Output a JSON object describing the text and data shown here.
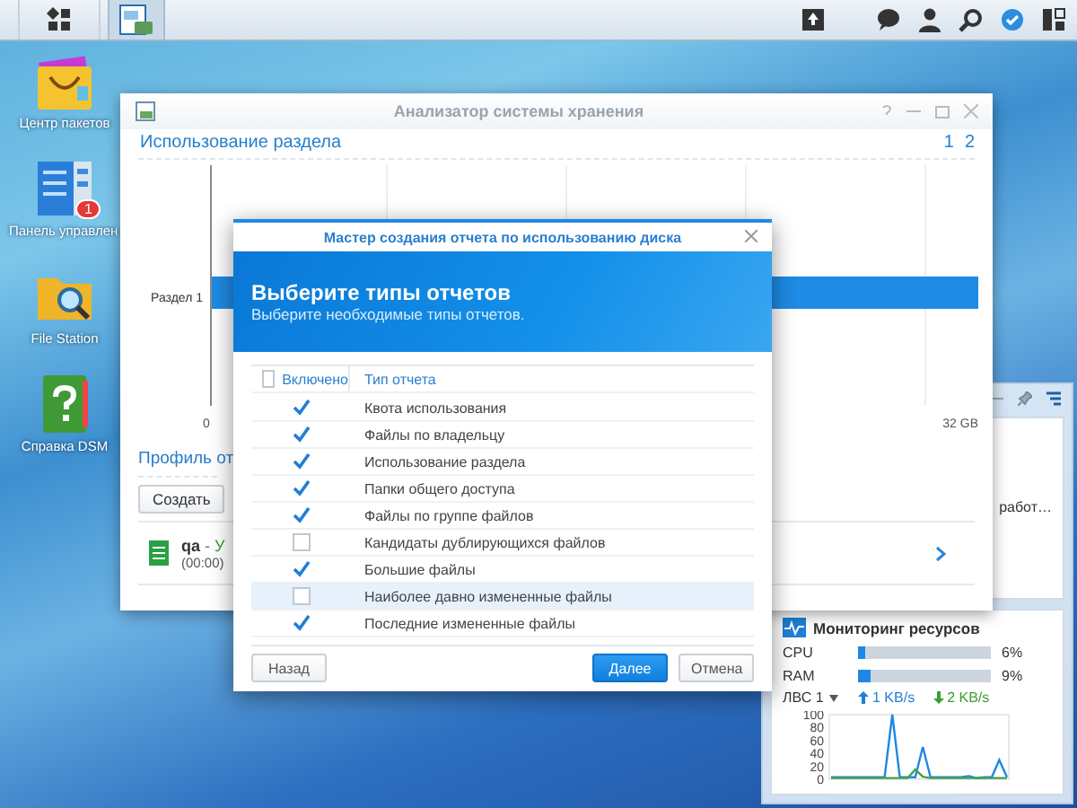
{
  "desktop_icons": [
    {
      "kind": "package",
      "label": "Центр пакетов"
    },
    {
      "kind": "control",
      "label": "Панель управлен",
      "badge": "1"
    },
    {
      "kind": "folder",
      "label": "File Station"
    },
    {
      "kind": "help",
      "label": "Справка DSM"
    }
  ],
  "analyzer_window": {
    "title": "Анализатор системы хранения",
    "section_title": "Использование раздела",
    "pages": [
      "1",
      "2"
    ],
    "chart": {
      "category": "Раздел 1",
      "axis_labels": [
        "0",
        "32 GB"
      ]
    },
    "profile_title": "Профиль от",
    "buttons": [
      "Создать"
    ],
    "report": {
      "name": "qa",
      "status": "- У",
      "time": "(00:00)"
    }
  },
  "wizard": {
    "title": "Мастер создания отчета по использованию диска",
    "heading": "Выберите типы отчетов",
    "subheading": "Выберите необходимые типы отчетов.",
    "columns": [
      "Включено",
      "Тип отчета"
    ],
    "header_checked": false,
    "rows": [
      {
        "label": "Квота использования",
        "checked": true,
        "selected": false
      },
      {
        "label": "Файлы по владельцу",
        "checked": true,
        "selected": false
      },
      {
        "label": "Использование раздела",
        "checked": true,
        "selected": false
      },
      {
        "label": "Папки общего доступа",
        "checked": true,
        "selected": false
      },
      {
        "label": "Файлы по группе файлов",
        "checked": true,
        "selected": false
      },
      {
        "label": "Кандидаты дублирующихся файлов",
        "checked": false,
        "selected": false
      },
      {
        "label": "Большие файлы",
        "checked": true,
        "selected": false
      },
      {
        "label": "Наиболее давно измененные файлы",
        "checked": false,
        "selected": true
      },
      {
        "label": "Последние измененные файлы",
        "checked": true,
        "selected": false
      }
    ],
    "buttons": [
      {
        "label": "Назад",
        "kind": "secondary"
      },
      {
        "label": "Далее",
        "kind": "primary"
      },
      {
        "label": "Отмена",
        "kind": "secondary"
      }
    ]
  },
  "widgets": {
    "status_text": "работ…",
    "monitor": {
      "title": "Мониторинг ресурсов",
      "meters": [
        {
          "name": "CPU",
          "level": 0.06,
          "reading": "6%"
        },
        {
          "name": "RAM",
          "level": 0.09,
          "reading": "9%"
        }
      ],
      "network": {
        "interface": "ЛВС 1",
        "upload": "1 KB/s",
        "download": "2 KB/s"
      },
      "chart_data": {
        "type": "line",
        "ylim": [
          0,
          100
        ],
        "yticks": [
          0,
          20,
          40,
          60,
          80,
          100
        ],
        "series": [
          {
            "color": "#1e88e5",
            "values": [
              3,
              3,
              3,
              3,
              3,
              3,
              3,
              3,
              100,
              3,
              3,
              3,
              50,
              3,
              3,
              3,
              3,
              3,
              5,
              2,
              3,
              3,
              30,
              3
            ]
          },
          {
            "color": "#43a047",
            "values": [
              2,
              2,
              2,
              2,
              2,
              2,
              2,
              2,
              2,
              2,
              2,
              15,
              4,
              2,
              2,
              2,
              2,
              2,
              2,
              2,
              2,
              2,
              2,
              2
            ]
          }
        ]
      }
    }
  }
}
